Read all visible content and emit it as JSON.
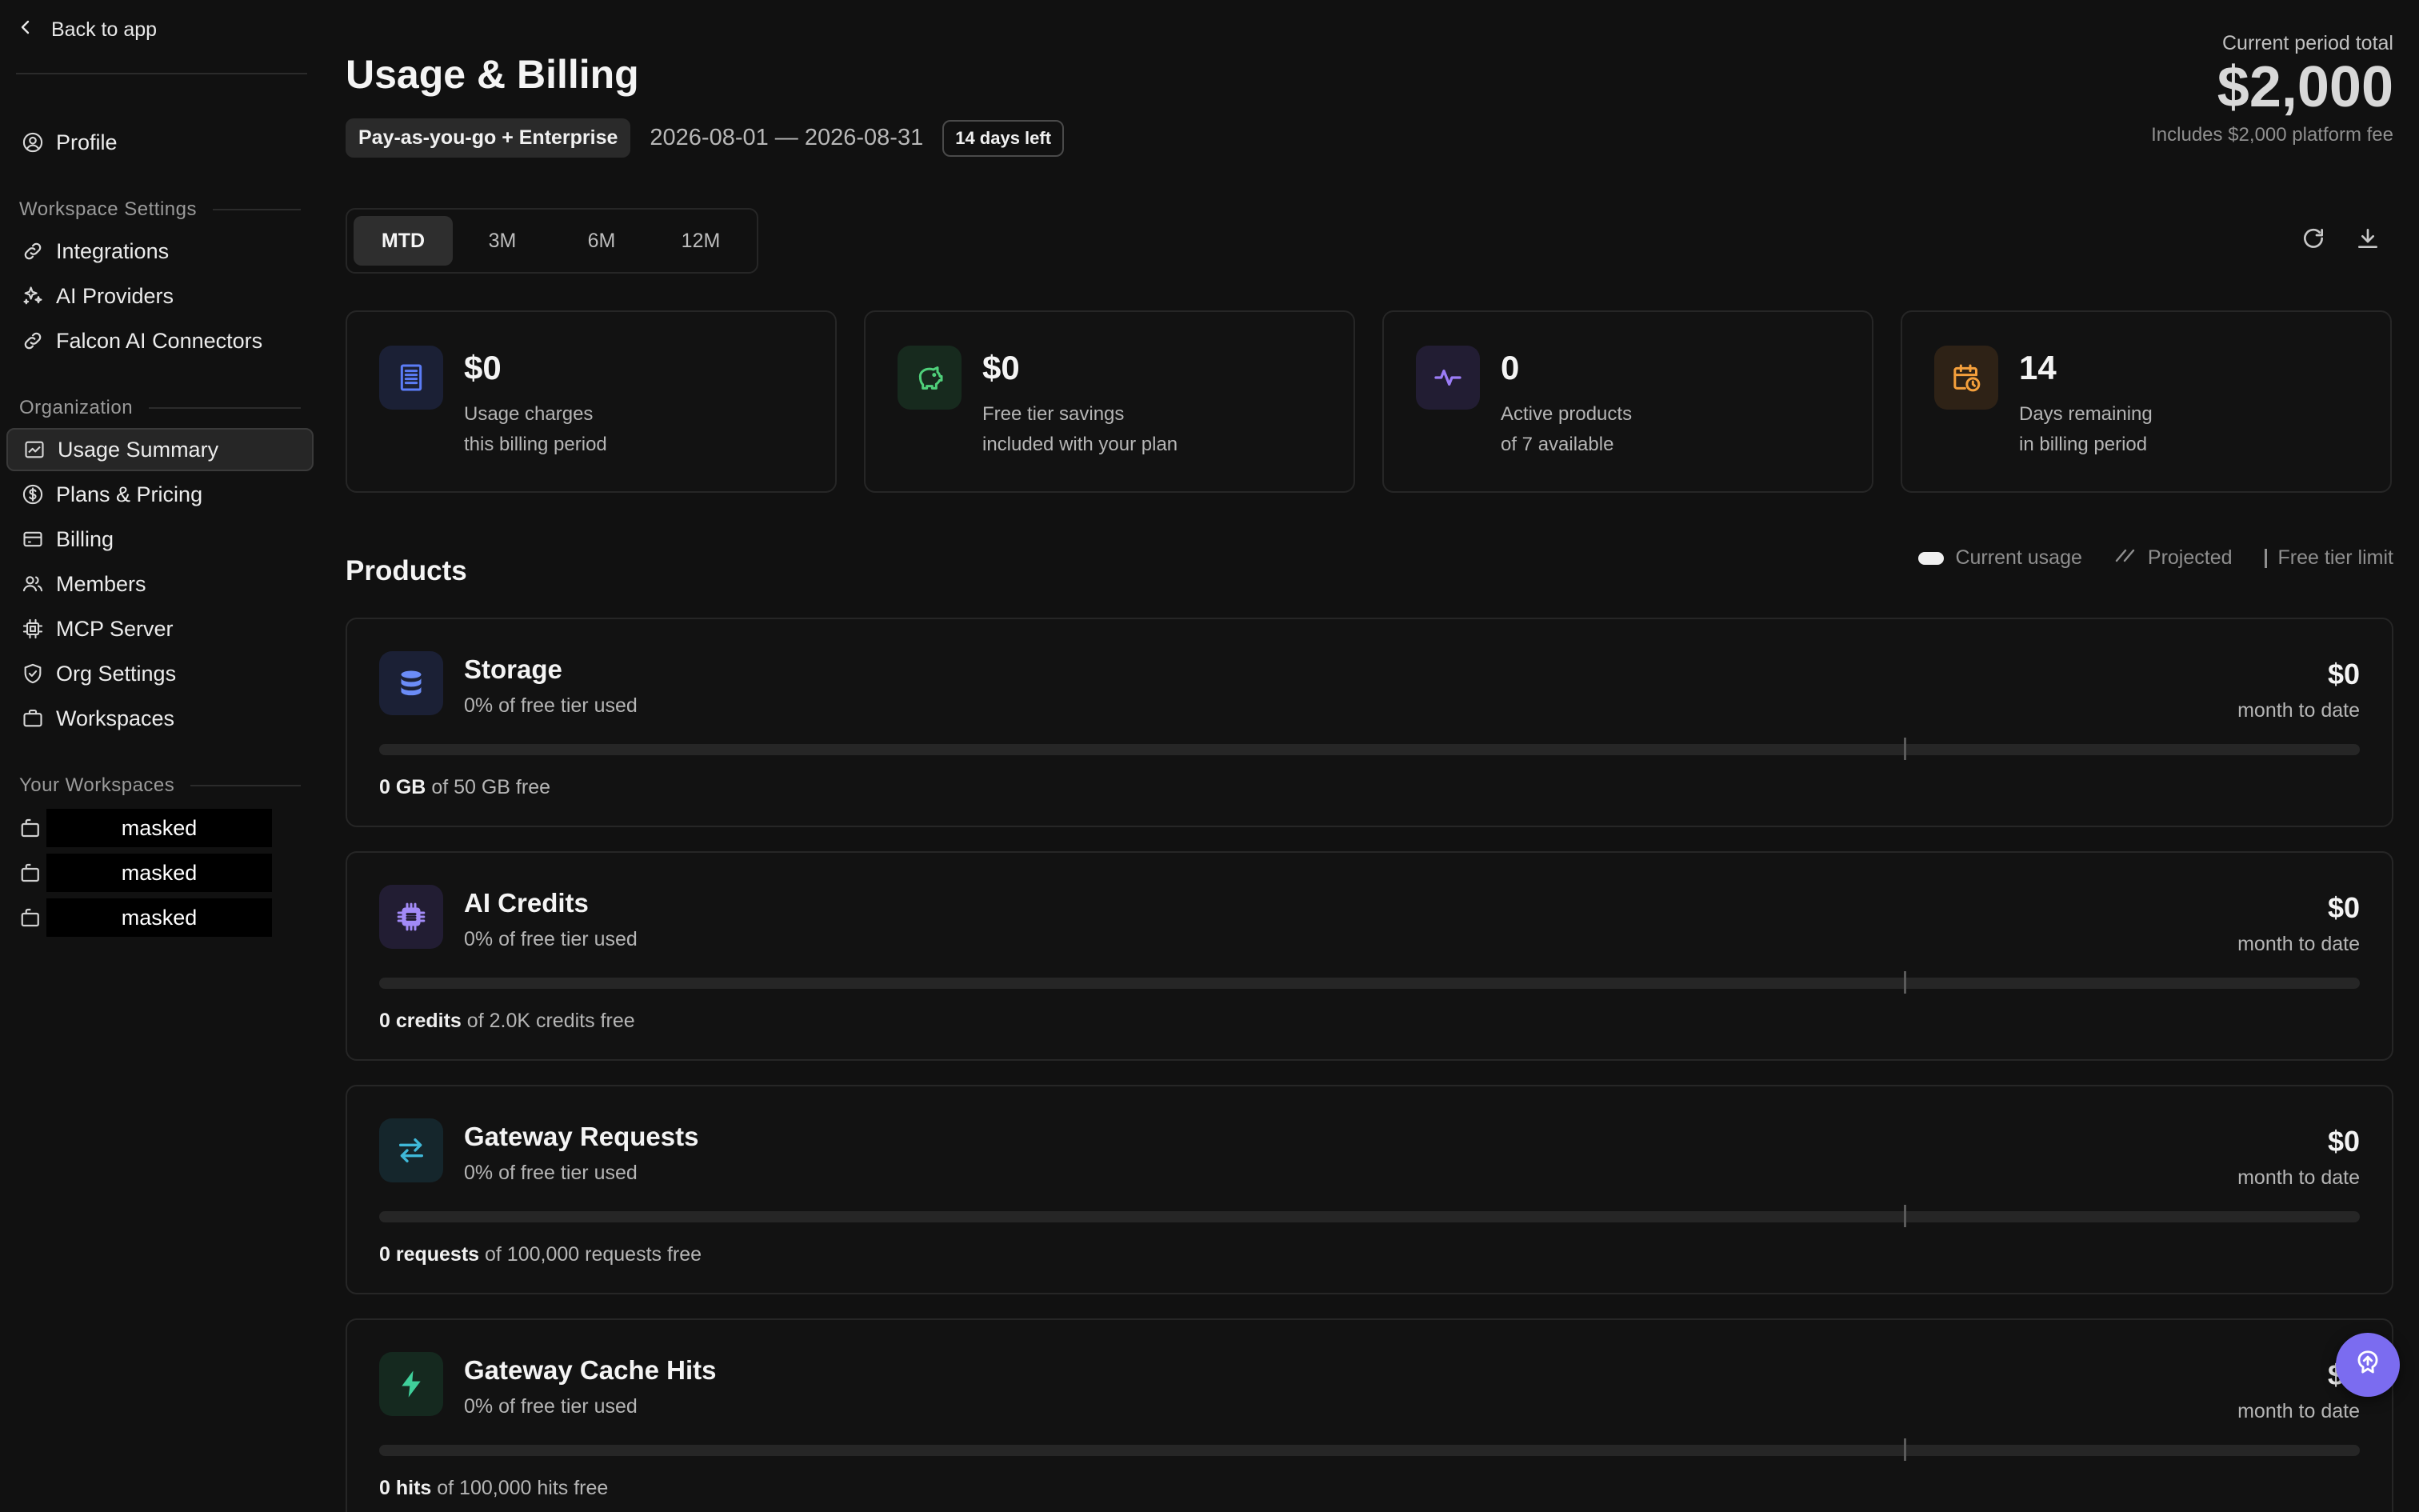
{
  "sidebar": {
    "back_label": "Back to app",
    "profile_label": "Profile",
    "workspace_settings": {
      "heading": "Workspace Settings",
      "items": [
        {
          "label": "Integrations",
          "icon": "link-icon"
        },
        {
          "label": "AI Providers",
          "icon": "sparkles-icon"
        },
        {
          "label": "Falcon AI Connectors",
          "icon": "link-icon"
        }
      ]
    },
    "organization": {
      "heading": "Organization",
      "items": [
        {
          "label": "Usage Summary",
          "icon": "chart-icon",
          "active": true
        },
        {
          "label": "Plans & Pricing",
          "icon": "dollar-circle-icon"
        },
        {
          "label": "Billing",
          "icon": "credit-card-icon"
        },
        {
          "label": "Members",
          "icon": "users-icon"
        },
        {
          "label": "MCP Server",
          "icon": "chip-icon"
        },
        {
          "label": "Org Settings",
          "icon": "shield-check-icon"
        },
        {
          "label": "Workspaces",
          "icon": "briefcase-icon"
        }
      ]
    },
    "your_workspaces": {
      "heading": "Your Workspaces",
      "items": [
        {
          "label": "masked",
          "icon": "briefcase-icon"
        },
        {
          "label": "masked",
          "icon": "briefcase-icon"
        },
        {
          "label": "masked",
          "icon": "briefcase-icon"
        }
      ]
    }
  },
  "header": {
    "title": "Usage & Billing",
    "plan": "Pay-as-you-go + Enterprise",
    "date_range": "2026-08-01 — 2026-08-31",
    "days_left": "14 days left",
    "total_label": "Current period total",
    "total_value": "$2,000",
    "total_note": "Includes $2,000 platform fee"
  },
  "period_tabs": [
    {
      "label": "MTD",
      "active": true
    },
    {
      "label": "3M"
    },
    {
      "label": "6M"
    },
    {
      "label": "12M"
    }
  ],
  "stats": [
    {
      "value": "$0",
      "line1": "Usage charges",
      "line2": "this billing period",
      "icon": "receipt-icon",
      "color": "#5b7cf6",
      "bg": "#1b2035"
    },
    {
      "value": "$0",
      "line1": "Free tier savings",
      "line2": "included with your plan",
      "icon": "piggy-bank-icon",
      "color": "#4fd07a",
      "bg": "#172a1e"
    },
    {
      "value": "0",
      "line1": "Active products",
      "line2": "of 7 available",
      "icon": "activity-icon",
      "color": "#9b7cf6",
      "bg": "#221d33"
    },
    {
      "value": "14",
      "line1": "Days remaining",
      "line2": "in billing period",
      "icon": "calendar-clock-icon",
      "color": "#f5a03c",
      "bg": "#2e2216"
    }
  ],
  "products_title": "Products",
  "legend": {
    "current": "Current usage",
    "projected": "Projected",
    "limit": "Free tier limit"
  },
  "products": [
    {
      "name": "Storage",
      "sub": "0% of free tier used",
      "amount": "$0",
      "period": "month to date",
      "used": "0 GB",
      "quota": "of 50 GB free",
      "icon": "database-icon",
      "color": "#6b8cf7",
      "bg": "#1b2035",
      "usage_fraction": 0.0
    },
    {
      "name": "AI Credits",
      "sub": "0% of free tier used",
      "amount": "$0",
      "period": "month to date",
      "used": "0 credits",
      "quota": "of 2.0K credits free",
      "icon": "cpu-icon",
      "color": "#a28af7",
      "bg": "#221d33",
      "usage_fraction": 0.0
    },
    {
      "name": "Gateway Requests",
      "sub": "0% of free tier used",
      "amount": "$0",
      "period": "month to date",
      "used": "0 requests",
      "quota": "of 100,000 requests free",
      "icon": "arrows-exchange-icon",
      "color": "#3fb8d8",
      "bg": "#15262c",
      "usage_fraction": 0.0
    },
    {
      "name": "Gateway Cache Hits",
      "sub": "0% of free tier used",
      "amount": "$0",
      "period": "month to date",
      "used": "0 hits",
      "quota": "of 100,000 hits free",
      "icon": "lightning-icon",
      "color": "#3fcf9a",
      "bg": "#15291f",
      "usage_fraction": 0.0
    }
  ],
  "fab_icon": "support-icon"
}
